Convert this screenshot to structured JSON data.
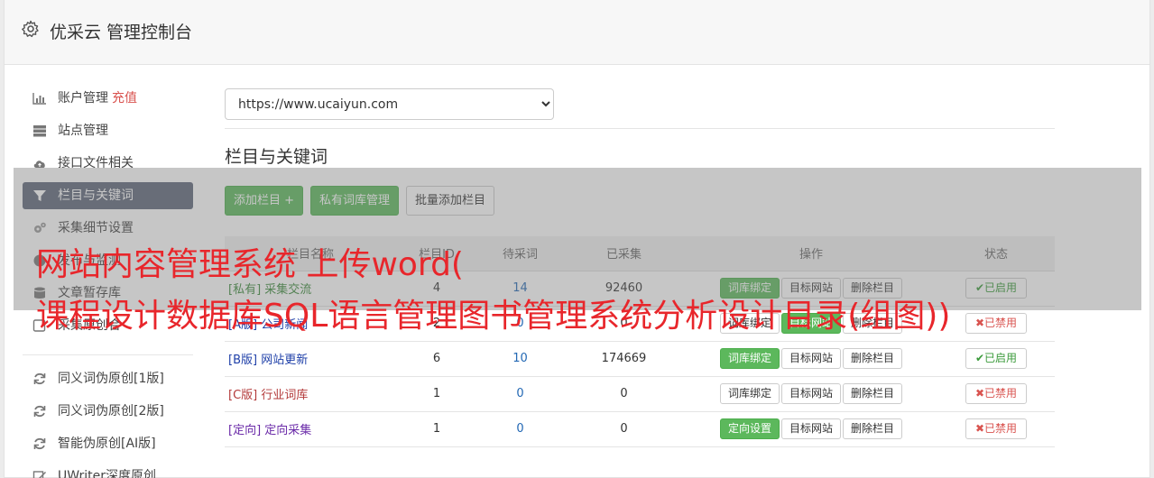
{
  "header": {
    "title": "优采云 管理控制台",
    "icon": "gear-icon"
  },
  "sidebar": {
    "items": [
      {
        "label": "账户管理",
        "badge": "充值",
        "icon": "bar-chart-icon"
      },
      {
        "label": "站点管理",
        "icon": "server-icon"
      },
      {
        "label": "接口文件相关",
        "icon": "cloud-upload-icon"
      },
      {
        "label": "栏目与关键词",
        "icon": "filter-icon",
        "active": true
      },
      {
        "label": "采集细节设置",
        "icon": "cogs-icon"
      },
      {
        "label": "发布与监测",
        "icon": "circle-icon"
      },
      {
        "label": "文章暂存库",
        "icon": "database-icon"
      },
      {
        "label": "采集原创合",
        "icon": "square-icon"
      }
    ],
    "tools": [
      {
        "label": "同义词伪原创[1版]",
        "icon": "refresh-icon"
      },
      {
        "label": "同义词伪原创[2版]",
        "icon": "refresh-icon"
      },
      {
        "label": "智能伪原创[AI版]",
        "icon": "refresh-icon"
      },
      {
        "label": "UWriter深度原创",
        "icon": "edit-icon"
      }
    ]
  },
  "site_select": {
    "value": "https://www.ucaiyun.com"
  },
  "section": {
    "title": "栏目与关键词"
  },
  "buttons": {
    "add_column": "添加栏目 +",
    "private_lib": "私有词库管理",
    "batch_add": "批量添加栏目"
  },
  "table": {
    "headers": [
      "栏目名称",
      "栏目ID",
      "待采词",
      "已采集",
      "操作",
      "状态"
    ],
    "rows": [
      {
        "tag": "[私有]",
        "name": "采集交流",
        "id": "4",
        "pending": "14",
        "collected": "92460",
        "op1": "词库绑定",
        "op1_green": true,
        "op2": "目标网站",
        "op3": "删除栏目",
        "status": "已启用",
        "status_on": true
      },
      {
        "tag": "[A版]",
        "name": "公司新闻",
        "id": "2",
        "pending": "0",
        "collected": "0",
        "op1": "词库绑定",
        "op1_green": false,
        "op2": "目标网站",
        "op3": "删除栏目",
        "status": "已禁用",
        "status_on": false
      },
      {
        "tag": "[B版]",
        "name": "网站更新",
        "id": "6",
        "pending": "10",
        "collected": "174669",
        "op1": "词库绑定",
        "op1_green": true,
        "op2": "目标网站",
        "op3": "删除栏目",
        "status": "已启用",
        "status_on": true
      },
      {
        "tag": "[C版]",
        "name": "行业词库",
        "id": "1",
        "pending": "0",
        "collected": "0",
        "op1": "词库绑定",
        "op1_green": false,
        "op2": "目标网站",
        "op3": "删除栏目",
        "status": "已禁用",
        "status_on": false
      },
      {
        "tag": "[定向]",
        "name": "定向采集",
        "id": "1",
        "pending": "0",
        "collected": "0",
        "op1": "定向设置",
        "op1_green": true,
        "op2": "目标网站",
        "op3": "删除栏目",
        "status": "已禁用",
        "status_on": false
      }
    ]
  },
  "overlay": {
    "line1": "网站内容管理系统 上传word(",
    "line2": "课程设计数据库SQL语言管理图书管理系统分析设计目录(组图))"
  },
  "colors": {
    "active_nav": "#5e6779",
    "green": "#5cb85c",
    "overlay_text": "#e8262b"
  }
}
